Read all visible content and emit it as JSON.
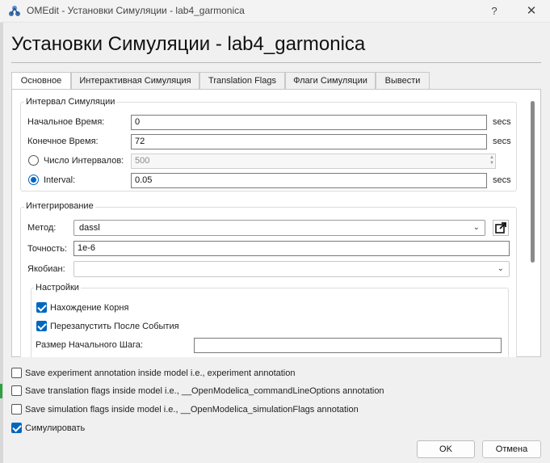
{
  "window": {
    "title": "OMEdit - Установки Симуляции - lab4_garmonica",
    "help_glyph": "?",
    "close_glyph": "✕"
  },
  "dialog": {
    "heading": "Установки Симуляции - lab4_garmonica"
  },
  "tabs": [
    {
      "label": "Основное",
      "active": true
    },
    {
      "label": "Интерактивная Симуляция",
      "active": false
    },
    {
      "label": "Translation Flags",
      "active": false
    },
    {
      "label": "Флаги Симуляции",
      "active": false
    },
    {
      "label": "Вывести",
      "active": false
    }
  ],
  "interval": {
    "group_title": "Интервал Симуляции",
    "start_label": "Начальное Время:",
    "start_value": "0",
    "start_units": "secs",
    "stop_label": "Конечное Время:",
    "stop_value": "72",
    "stop_units": "secs",
    "num_intervals_label": "Число Интервалов:",
    "num_intervals_value": "500",
    "num_intervals_checked": false,
    "interval_label": "Interval:",
    "interval_value": "0.05",
    "interval_units": "secs",
    "interval_checked": true
  },
  "integration": {
    "group_title": "Интегрирование",
    "method_label": "Метод:",
    "method_value": "dassl",
    "tolerance_label": "Точность:",
    "tolerance_value": "1e-6",
    "jacobian_label": "Якобиан:",
    "jacobian_value": "",
    "settings_title": "Настройки",
    "root_finding_label": "Нахождение Корня",
    "root_finding_checked": true,
    "restart_label": "Перезапустить После События",
    "restart_checked": true,
    "initial_step_label": "Размер Начального Шага:",
    "initial_step_value": ""
  },
  "options": [
    {
      "label": "Save experiment annotation inside model i.e., experiment annotation",
      "checked": false
    },
    {
      "label": "Save translation flags inside model i.e., __OpenModelica_commandLineOptions annotation",
      "checked": false
    },
    {
      "label": "Save simulation flags inside model i.e., __OpenModelica_simulationFlags annotation",
      "checked": false
    },
    {
      "label": "Симулировать",
      "checked": true
    }
  ],
  "buttons": {
    "ok": "OK",
    "cancel": "Отмена"
  },
  "colors": {
    "accent": "#0067c0",
    "window_bg": "#f0f0f0"
  }
}
